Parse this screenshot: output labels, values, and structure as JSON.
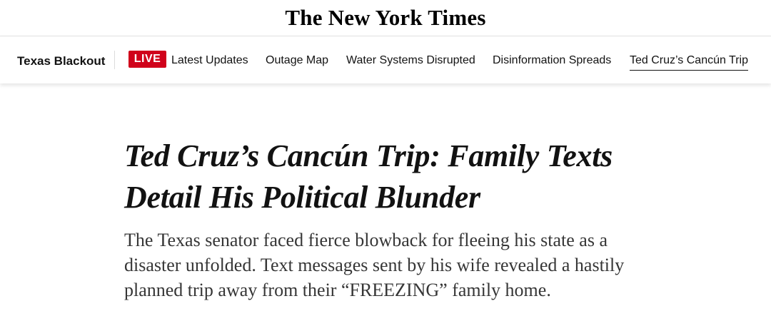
{
  "masthead": {
    "logo_text": "The New York Times"
  },
  "subnav": {
    "section_label": "Texas Blackout",
    "live_badge": "LIVE",
    "items": [
      {
        "label": "Latest Updates"
      },
      {
        "label": "Outage Map"
      },
      {
        "label": "Water Systems Disrupted"
      },
      {
        "label": "Disinformation Spreads"
      },
      {
        "label": "Ted Cruz’s Cancún Trip",
        "active": true
      }
    ]
  },
  "article": {
    "headline": "Ted Cruz’s Cancún Trip: Family Texts Detail His Political Blunder",
    "summary": "The Texas senator faced fierce blowback for fleeing his state as a disaster unfolded. Text messages sent by his wife revealed a hastily planned trip away from their “FREEZING” family home."
  },
  "colors": {
    "live_badge": "#d0021b",
    "text": "#121212",
    "summary_text": "#363636"
  }
}
